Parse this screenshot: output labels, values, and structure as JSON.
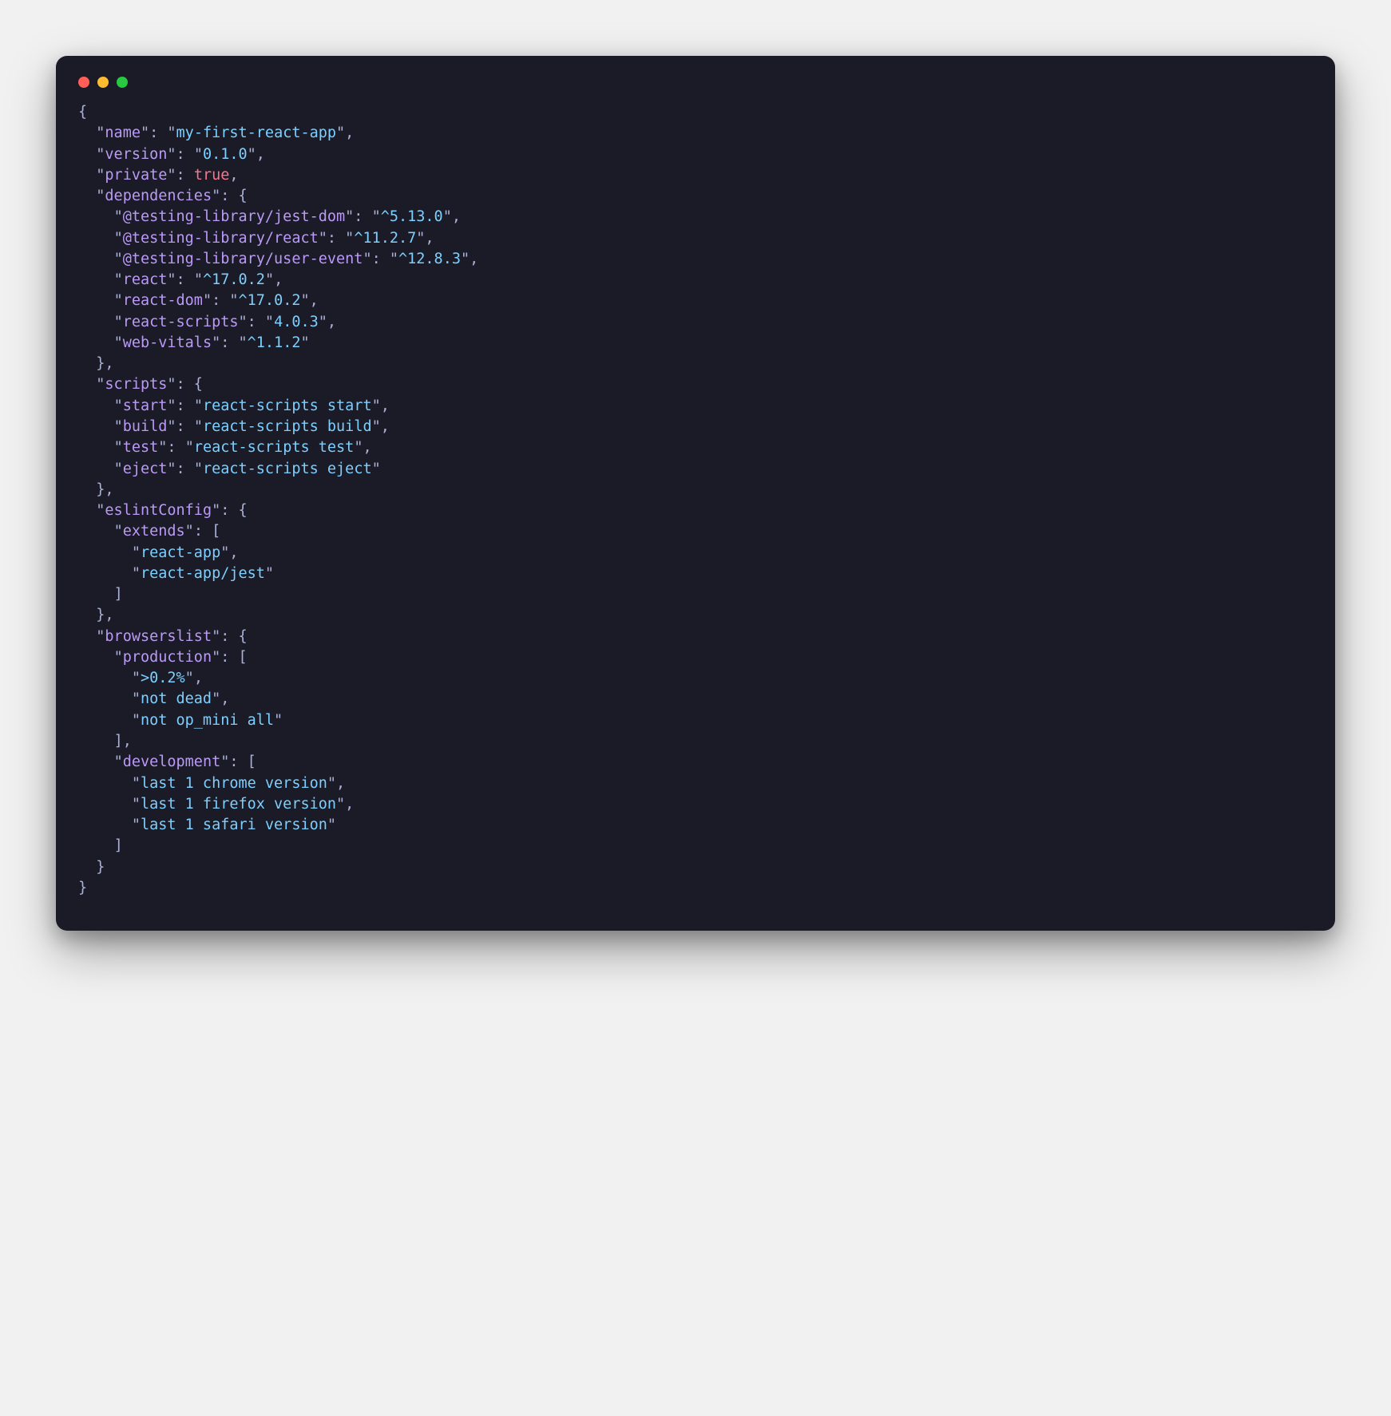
{
  "pkg": {
    "name": "my-first-react-app",
    "version": "0.1.0",
    "private_bool": "true",
    "dependencies": {
      "jest_dom_key": "@testing-library/jest-dom",
      "jest_dom_val": "^5.13.0",
      "react_lib_key": "@testing-library/react",
      "react_lib_val": "^11.2.7",
      "user_event_key": "@testing-library/user-event",
      "user_event_val": "^12.8.3",
      "react_key": "react",
      "react_val": "^17.0.2",
      "react_dom_key": "react-dom",
      "react_dom_val": "^17.0.2",
      "react_scripts_key": "react-scripts",
      "react_scripts_val": "4.0.3",
      "web_vitals_key": "web-vitals",
      "web_vitals_val": "^1.1.2"
    },
    "scripts": {
      "start_key": "start",
      "start_val": "react-scripts start",
      "build_key": "build",
      "build_val": "react-scripts build",
      "test_key": "test",
      "test_val": "react-scripts test",
      "eject_key": "eject",
      "eject_val": "react-scripts eject"
    },
    "eslintConfig": {
      "extends_key": "extends",
      "ext0": "react-app",
      "ext1": "react-app/jest"
    },
    "browserslist": {
      "production_key": "production",
      "prod0": ">0.2%",
      "prod1": "not dead",
      "prod2": "not op_mini all",
      "development_key": "development",
      "dev0": "last 1 chrome version",
      "dev1": "last 1 firefox version",
      "dev2": "last 1 safari version"
    },
    "keys": {
      "name": "name",
      "version": "version",
      "private": "private",
      "dependencies": "dependencies",
      "scripts": "scripts",
      "eslintConfig": "eslintConfig",
      "browserslist": "browserslist"
    }
  }
}
